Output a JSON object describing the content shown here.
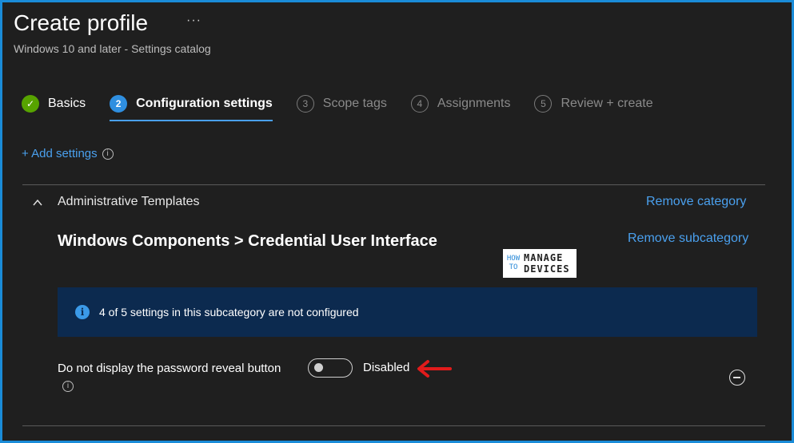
{
  "header": {
    "title": "Create profile",
    "more": "···",
    "subtitle": "Windows 10 and later - Settings catalog"
  },
  "steps": [
    {
      "num": "✓",
      "label": "Basics",
      "state": "done"
    },
    {
      "num": "2",
      "label": "Configuration settings",
      "state": "active"
    },
    {
      "num": "3",
      "label": "Scope tags",
      "state": "pending"
    },
    {
      "num": "4",
      "label": "Assignments",
      "state": "pending"
    },
    {
      "num": "5",
      "label": "Review + create",
      "state": "pending"
    }
  ],
  "add_settings": {
    "label": "+ Add settings",
    "info": "i"
  },
  "category": {
    "title": "Administrative Templates",
    "remove_label": "Remove category"
  },
  "subcategory": {
    "title": "Windows Components > Credential User Interface",
    "remove_label": "Remove subcategory"
  },
  "logo": {
    "how": [
      "HOW",
      "TO"
    ],
    "brand": [
      "MANAGE",
      "DEVICES"
    ]
  },
  "banner": {
    "icon": "i",
    "text": "4 of 5 settings in this subcategory are not configured"
  },
  "setting": {
    "label": "Do not display the password reveal button",
    "info": "i",
    "toggle_state": "Disabled",
    "toggle_on": false
  },
  "colors": {
    "accent": "#4aa0ee",
    "success": "#57a300",
    "banner_bg": "#0c2a4f",
    "arrow": "#e11b1b"
  }
}
